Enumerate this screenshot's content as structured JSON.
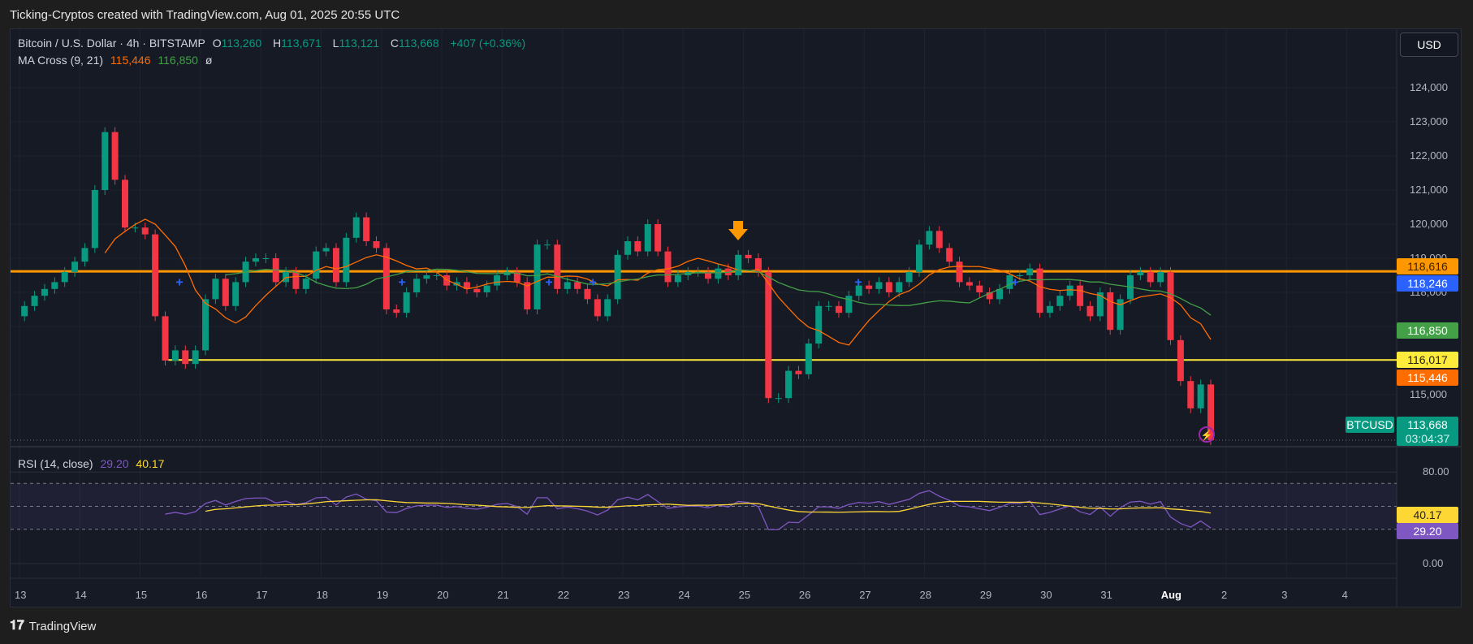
{
  "caption": "Ticking-Cryptos created with TradingView.com, Aug 01, 2025 20:55 UTC",
  "symbol": {
    "name": "Bitcoin / U.S. Dollar · 4h · BITSTAMP",
    "o_label": "O",
    "o": "113,260",
    "h_label": "H",
    "h": "113,671",
    "l_label": "L",
    "l": "113,121",
    "c_label": "C",
    "c": "113,668",
    "change": "+407 (+0.36%)"
  },
  "ma": {
    "label": "MA Cross (9, 21)",
    "fast": "115,446",
    "slow": "116,850",
    "extra": "ø"
  },
  "rsi": {
    "label": "RSI (14, close)",
    "value": "29.20",
    "ma_value": "40.17"
  },
  "currency_button": "USD",
  "price_axis": [
    "124,000",
    "123,000",
    "122,000",
    "121,000",
    "120,000",
    "119,000",
    "118,000",
    "117,000",
    "115,000"
  ],
  "price_axis_values": [
    124000,
    123000,
    122000,
    121000,
    120000,
    119000,
    118000,
    117000,
    115000
  ],
  "rsi_axis": [
    "80.00",
    "0.00"
  ],
  "badges": {
    "resistance": "118,616",
    "blue": "118,246",
    "ma_slow": "116,850",
    "support": "116,017",
    "ma_fast": "115,446",
    "symbol": "BTCUSD",
    "last": "113,668",
    "countdown": "03:04:37"
  },
  "levels": {
    "resistance": 118616,
    "support": 116017,
    "last": 113668
  },
  "colors": {
    "up": "#089981",
    "down": "#f23645",
    "ma_fast": "#ff6d00",
    "ma_slow": "#43a047",
    "resistance": "#ff9800",
    "support": "#ffeb3b",
    "blue": "#2962ff",
    "rsi": "#7e57c2",
    "rsi_ma": "#fdd835"
  },
  "date_axis": [
    "13",
    "14",
    "15",
    "16",
    "17",
    "18",
    "19",
    "20",
    "21",
    "22",
    "23",
    "24",
    "25",
    "26",
    "27",
    "28",
    "29",
    "30",
    "31",
    "Aug",
    "2",
    "3",
    "4"
  ],
  "chart_data": {
    "type": "candlestick",
    "interval": "4h",
    "closes": [
      117600,
      117900,
      118100,
      118300,
      118600,
      118900,
      119300,
      121000,
      122700,
      121300,
      119900,
      119900,
      119700,
      117300,
      116000,
      116300,
      115900,
      116300,
      117800,
      118400,
      117600,
      118300,
      118900,
      119000,
      119000,
      118300,
      118600,
      118100,
      118400,
      119200,
      119300,
      118300,
      119600,
      120200,
      119500,
      119300,
      117500,
      117400,
      118000,
      118400,
      118500,
      118500,
      118200,
      118300,
      118100,
      118000,
      118200,
      118500,
      118600,
      118300,
      117500,
      119400,
      119400,
      118100,
      118300,
      118100,
      117800,
      117300,
      117800,
      119100,
      119500,
      119200,
      120000,
      119200,
      118300,
      118500,
      118600,
      118600,
      118400,
      118700,
      118500,
      119100,
      119000,
      118600,
      114900,
      114900,
      115700,
      115600,
      116500,
      117600,
      117600,
      117400,
      117900,
      118200,
      118100,
      118300,
      118000,
      118300,
      118600,
      119400,
      119800,
      119300,
      118900,
      118300,
      118200,
      118000,
      117800,
      118100,
      118500,
      118500,
      118700,
      117400,
      117600,
      117900,
      118200,
      117600,
      117300,
      118000,
      116900,
      117800,
      118500,
      118600,
      118300,
      118600,
      116600,
      115400,
      114600,
      115300,
      113668
    ],
    "first_open": 117300,
    "ylim": [
      113000,
      125000
    ],
    "indicators": [
      "SMA 9",
      "SMA 21",
      "RSI 14",
      "RSI MA 14"
    ]
  }
}
